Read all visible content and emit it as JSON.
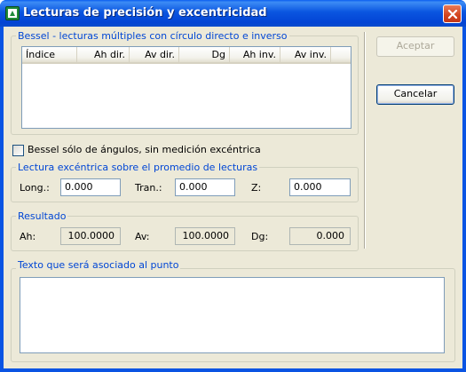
{
  "window": {
    "title": "Lecturas de precisión y excentricidad"
  },
  "bessel_group": {
    "legend": "Bessel - lecturas múltiples con círculo directo e inverso",
    "columns": [
      "Índice",
      "Ah dir.",
      "Av dir.",
      "Dg",
      "Ah inv.",
      "Av inv."
    ]
  },
  "bessel_checkbox": {
    "label": "Bessel sólo de ángulos, sin medición excéntrica",
    "checked": false
  },
  "eccentric_group": {
    "legend": "Lectura excéntrica sobre el promedio de lecturas",
    "long_label": "Long.:",
    "long_value": "0.000",
    "tran_label": "Tran.:",
    "tran_value": "0.000",
    "z_label": "Z:",
    "z_value": "0.000"
  },
  "result_group": {
    "legend": "Resultado",
    "ah_label": "Ah:",
    "ah_value": "100.0000",
    "av_label": "Av:",
    "av_value": "100.0000",
    "dg_label": "Dg:",
    "dg_value": "0.000"
  },
  "text_group": {
    "legend": "Texto que será asociado al punto",
    "value": ""
  },
  "buttons": {
    "accept": "Aceptar",
    "cancel": "Cancelar"
  }
}
